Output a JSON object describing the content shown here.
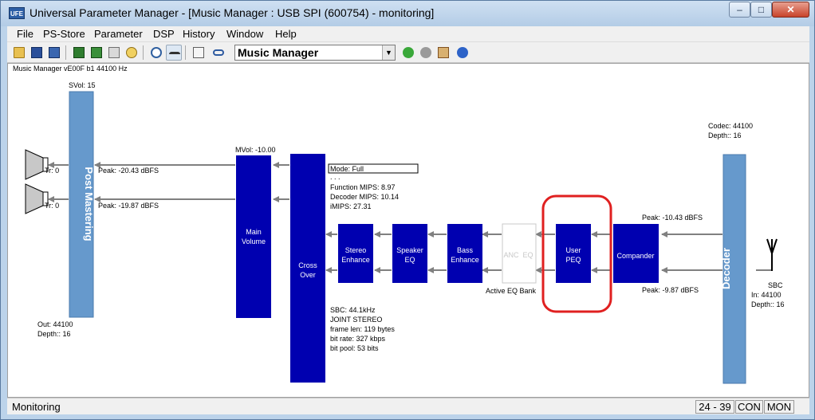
{
  "window": {
    "app_icon": "UFE",
    "title": "Universal Parameter Manager - [Music Manager : USB SPI (600754) - monitoring]",
    "minimize_glyph": "–",
    "maximize_glyph": "□",
    "close_glyph": "✕"
  },
  "menu": {
    "items": [
      {
        "label": "File"
      },
      {
        "label": "PS-Store"
      },
      {
        "label": "Parameter"
      },
      {
        "label": "DSP"
      },
      {
        "label": "History"
      },
      {
        "label": "Window"
      },
      {
        "label": "Help"
      }
    ]
  },
  "toolbar": {
    "combo_value": "Music Manager",
    "combo_arrow": "▼",
    "icons": [
      "open-folder-icon",
      "save-icon",
      "save-as-icon",
      "chip-read-icon",
      "chip-write-icon",
      "import-icon",
      "search-icon",
      "clock-icon",
      "glasses-icon",
      "clipboard-icon",
      "link-icon",
      "back-icon",
      "forward-icon",
      "home-icon",
      "help-icon"
    ]
  },
  "diagram": {
    "header": "Music Manager vE00F b1 44100 Hz",
    "svol": "SVol: 15",
    "post_mastering": "Post Mastering",
    "tr1": "Tr: 0",
    "tr2": "Tr: 0",
    "peak_l": "Peak: -20.43 dBFS",
    "peak_r": "Peak: -19.87 dBFS",
    "out": "Out: 44100",
    "out_depth": "Depth:: 16",
    "mvol": "MVol: -10.00",
    "main_volume_1": "Main",
    "main_volume_2": "Volume",
    "crossover_1": "Cross",
    "crossover_2": "Over",
    "mode": "Mode: Full",
    "dots": ". . .",
    "function_mips": "Function MIPS: 8.97",
    "decoder_mips": "Decoder MIPS: 10.14",
    "imips": "iMIPS: 27.31",
    "stereo_1": "Stereo",
    "stereo_2": "Enhance",
    "speaker_1": "Speaker",
    "speaker_2": "EQ",
    "bass_1": "Bass",
    "bass_2": "Enhance",
    "anc": "ANC",
    "eq": "EQ",
    "active_eq": "Active EQ Bank",
    "user_1": "User",
    "user_2": "PEQ",
    "compander": "Compander",
    "peak_in_1": "Peak: -10.43 dBFS",
    "peak_in_2": "Peak: -9.87 dBFS",
    "decoder": "Decoder",
    "codec": "Codec: 44100",
    "codec_depth": "Depth:: 16",
    "sbc": "SBC",
    "in": "In: 44100",
    "in_depth": "Depth:: 16",
    "sbc_info": [
      "SBC: 44.1kHz",
      "JOINT STEREO",
      "frame len: 119 bytes",
      "bit rate: 327 kbps",
      "bit pool: 53 bits"
    ]
  },
  "status": {
    "text": "Monitoring",
    "position": "24 - 39",
    "con": "CON",
    "mon": "MON"
  },
  "colors": {
    "block": "#0000b0",
    "post_mastering_bar": "#6699cc",
    "highlight_ring": "#e02020",
    "signal_line": "#808080"
  }
}
